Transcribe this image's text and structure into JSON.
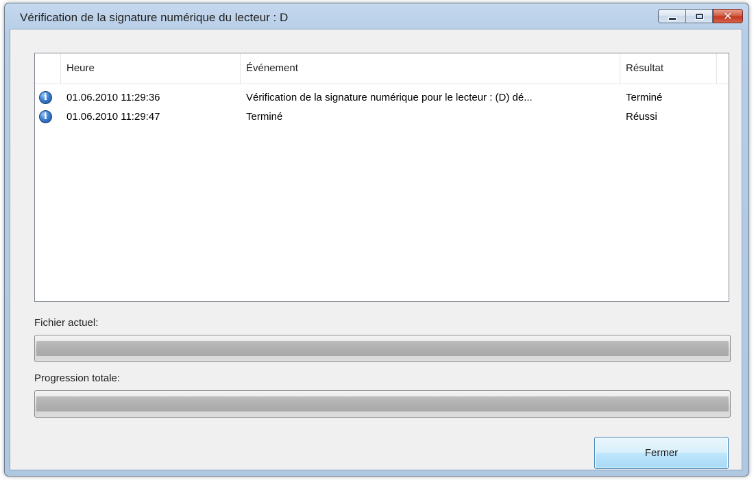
{
  "window": {
    "title": "Vérification de la signature numérique du lecteur : D",
    "buttons": {
      "minimize": "minimize-icon",
      "maximize": "maximize-icon",
      "close": "close-icon"
    }
  },
  "log": {
    "columns": {
      "time": "Heure",
      "event": "Événement",
      "result": "Résultat"
    },
    "rows": [
      {
        "icon": "info-icon",
        "time": "01.06.2010 11:29:36",
        "event": "Vérification de la signature numérique pour le lecteur : (D) dé...",
        "result": "Terminé"
      },
      {
        "icon": "info-icon",
        "time": "01.06.2010 11:29:47",
        "event": "Terminé",
        "result": "Réussi"
      }
    ]
  },
  "progress": {
    "current_file_label": "Fichier actuel:",
    "current_file_value": 0,
    "total_label": "Progression totale:",
    "total_value": 0
  },
  "footer": {
    "close_label": "Fermer"
  },
  "colors": {
    "title_bar": "#b6cde6",
    "close_button": "#c53820",
    "button_border": "#3c7fb1"
  }
}
